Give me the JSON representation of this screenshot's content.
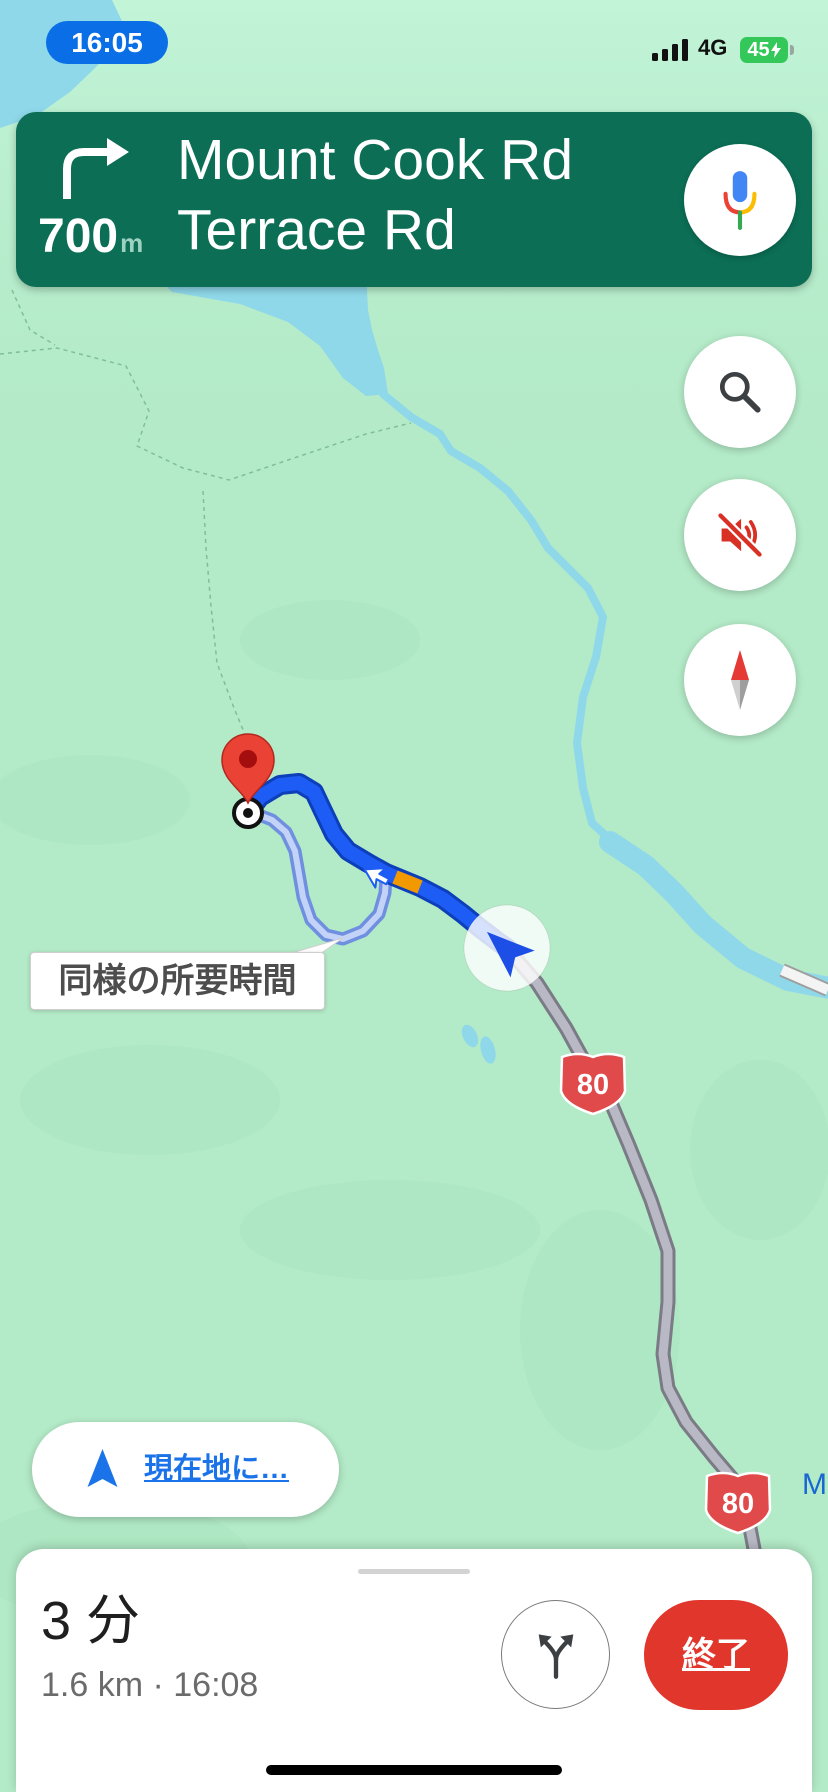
{
  "status_bar": {
    "time": "16:05",
    "network": "4G",
    "battery_level": "45",
    "icons": [
      "signal-icon",
      "charging-icon"
    ]
  },
  "nav_banner": {
    "distance": "700",
    "distance_unit": "m",
    "street_primary": "Mount Cook Rd",
    "street_secondary": "Terrace Rd",
    "turn_icon": "turn-right-icon",
    "mic_icon": "mic-icon"
  },
  "map_controls": {
    "icons": [
      "search-icon",
      "volume-off-icon",
      "compass-icon"
    ]
  },
  "map": {
    "route_label": "同様の所要時間",
    "highway_shields": [
      "80",
      "80"
    ],
    "edge_label": "M",
    "icons": [
      "destination-pin-icon",
      "current-location-arrow-icon",
      "maneuver-arrow-icon"
    ]
  },
  "recenter": {
    "label": "現在地に…",
    "icon": "navigation-arrow-icon"
  },
  "trip_summary": {
    "duration": "3 分",
    "details": "1.6 km · 16:08",
    "alt_routes_icon": "alt-routes-icon",
    "end_label": "終了"
  },
  "colors": {
    "banner": "#0b6e55",
    "route": "#1d5cf5",
    "route_slow_traffic": "#f29900",
    "alternate_route": "#c3d2f7",
    "road": "#b9b9c6",
    "highway_shield": "#e04a4a",
    "water": "#8fd8ea",
    "map_land": "#b3eac7",
    "link": "#1a73e8",
    "end_button": "#e0362c",
    "time_pill": "#0a6ee6"
  }
}
